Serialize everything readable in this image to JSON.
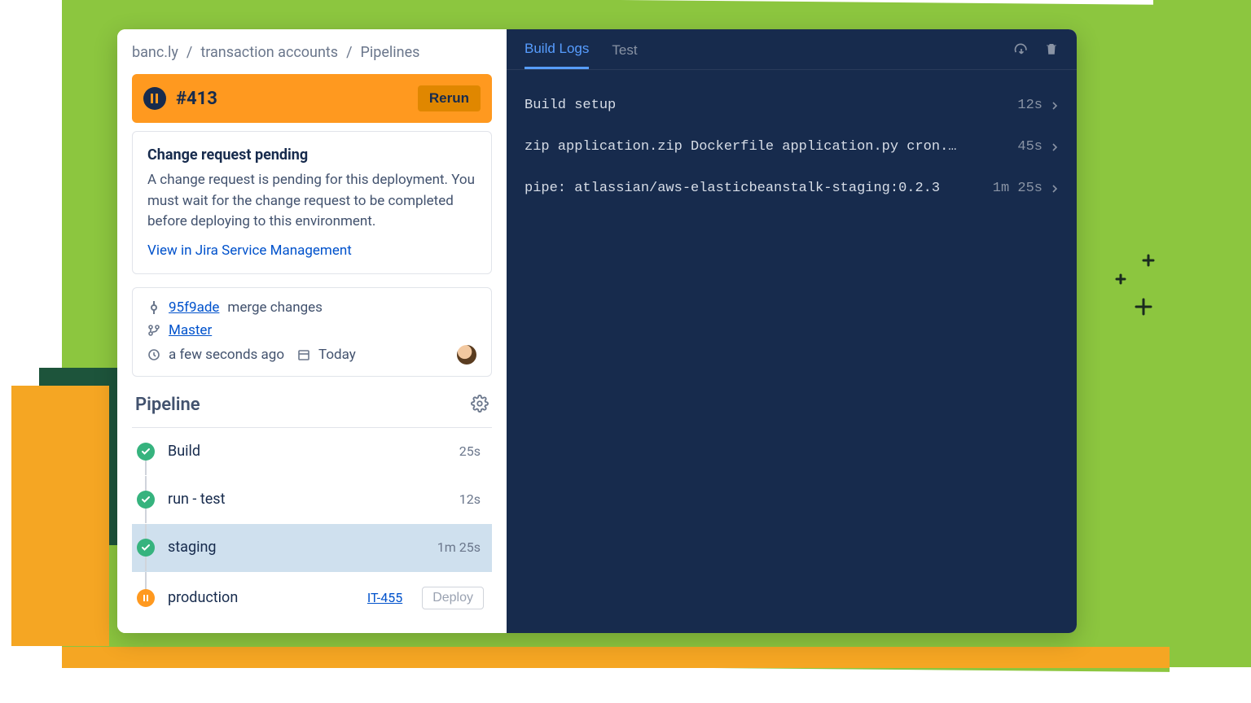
{
  "breadcrumb": [
    "banc.ly",
    "transaction accounts",
    "Pipelines"
  ],
  "run": {
    "id": "#413",
    "rerun_label": "Rerun"
  },
  "change_request": {
    "title": "Change request pending",
    "body": "A change request is pending for this deployment. You must wait for the change request to be completed before deploying to this environment.",
    "link_label": "View in Jira Service Management"
  },
  "commit": {
    "hash": "95f9ade",
    "message": "merge changes",
    "branch": "Master",
    "relative_time": "a few seconds ago",
    "date_label": "Today"
  },
  "pipeline": {
    "title": "Pipeline",
    "steps": [
      {
        "name": "Build",
        "status": "success",
        "duration": "25s",
        "selected": false,
        "ticket": "",
        "action": ""
      },
      {
        "name": "run - test",
        "status": "success",
        "duration": "12s",
        "selected": false,
        "ticket": "",
        "action": ""
      },
      {
        "name": "staging",
        "status": "success",
        "duration": "1m 25s",
        "selected": true,
        "ticket": "",
        "action": ""
      },
      {
        "name": "production",
        "status": "paused",
        "duration": "",
        "selected": false,
        "ticket": "IT-455",
        "action": "Deploy"
      }
    ]
  },
  "logs": {
    "tabs": [
      {
        "label": "Build Logs",
        "active": true
      },
      {
        "label": "Test",
        "active": false
      }
    ],
    "lines": [
      {
        "text": "Build setup",
        "duration": "12s"
      },
      {
        "text": "zip application.zip Dockerfile application.py cron.y...",
        "duration": "45s"
      },
      {
        "text": "pipe: atlassian/aws-elasticbeanstalk-staging:0.2.3",
        "duration": "1m 25s"
      }
    ]
  }
}
